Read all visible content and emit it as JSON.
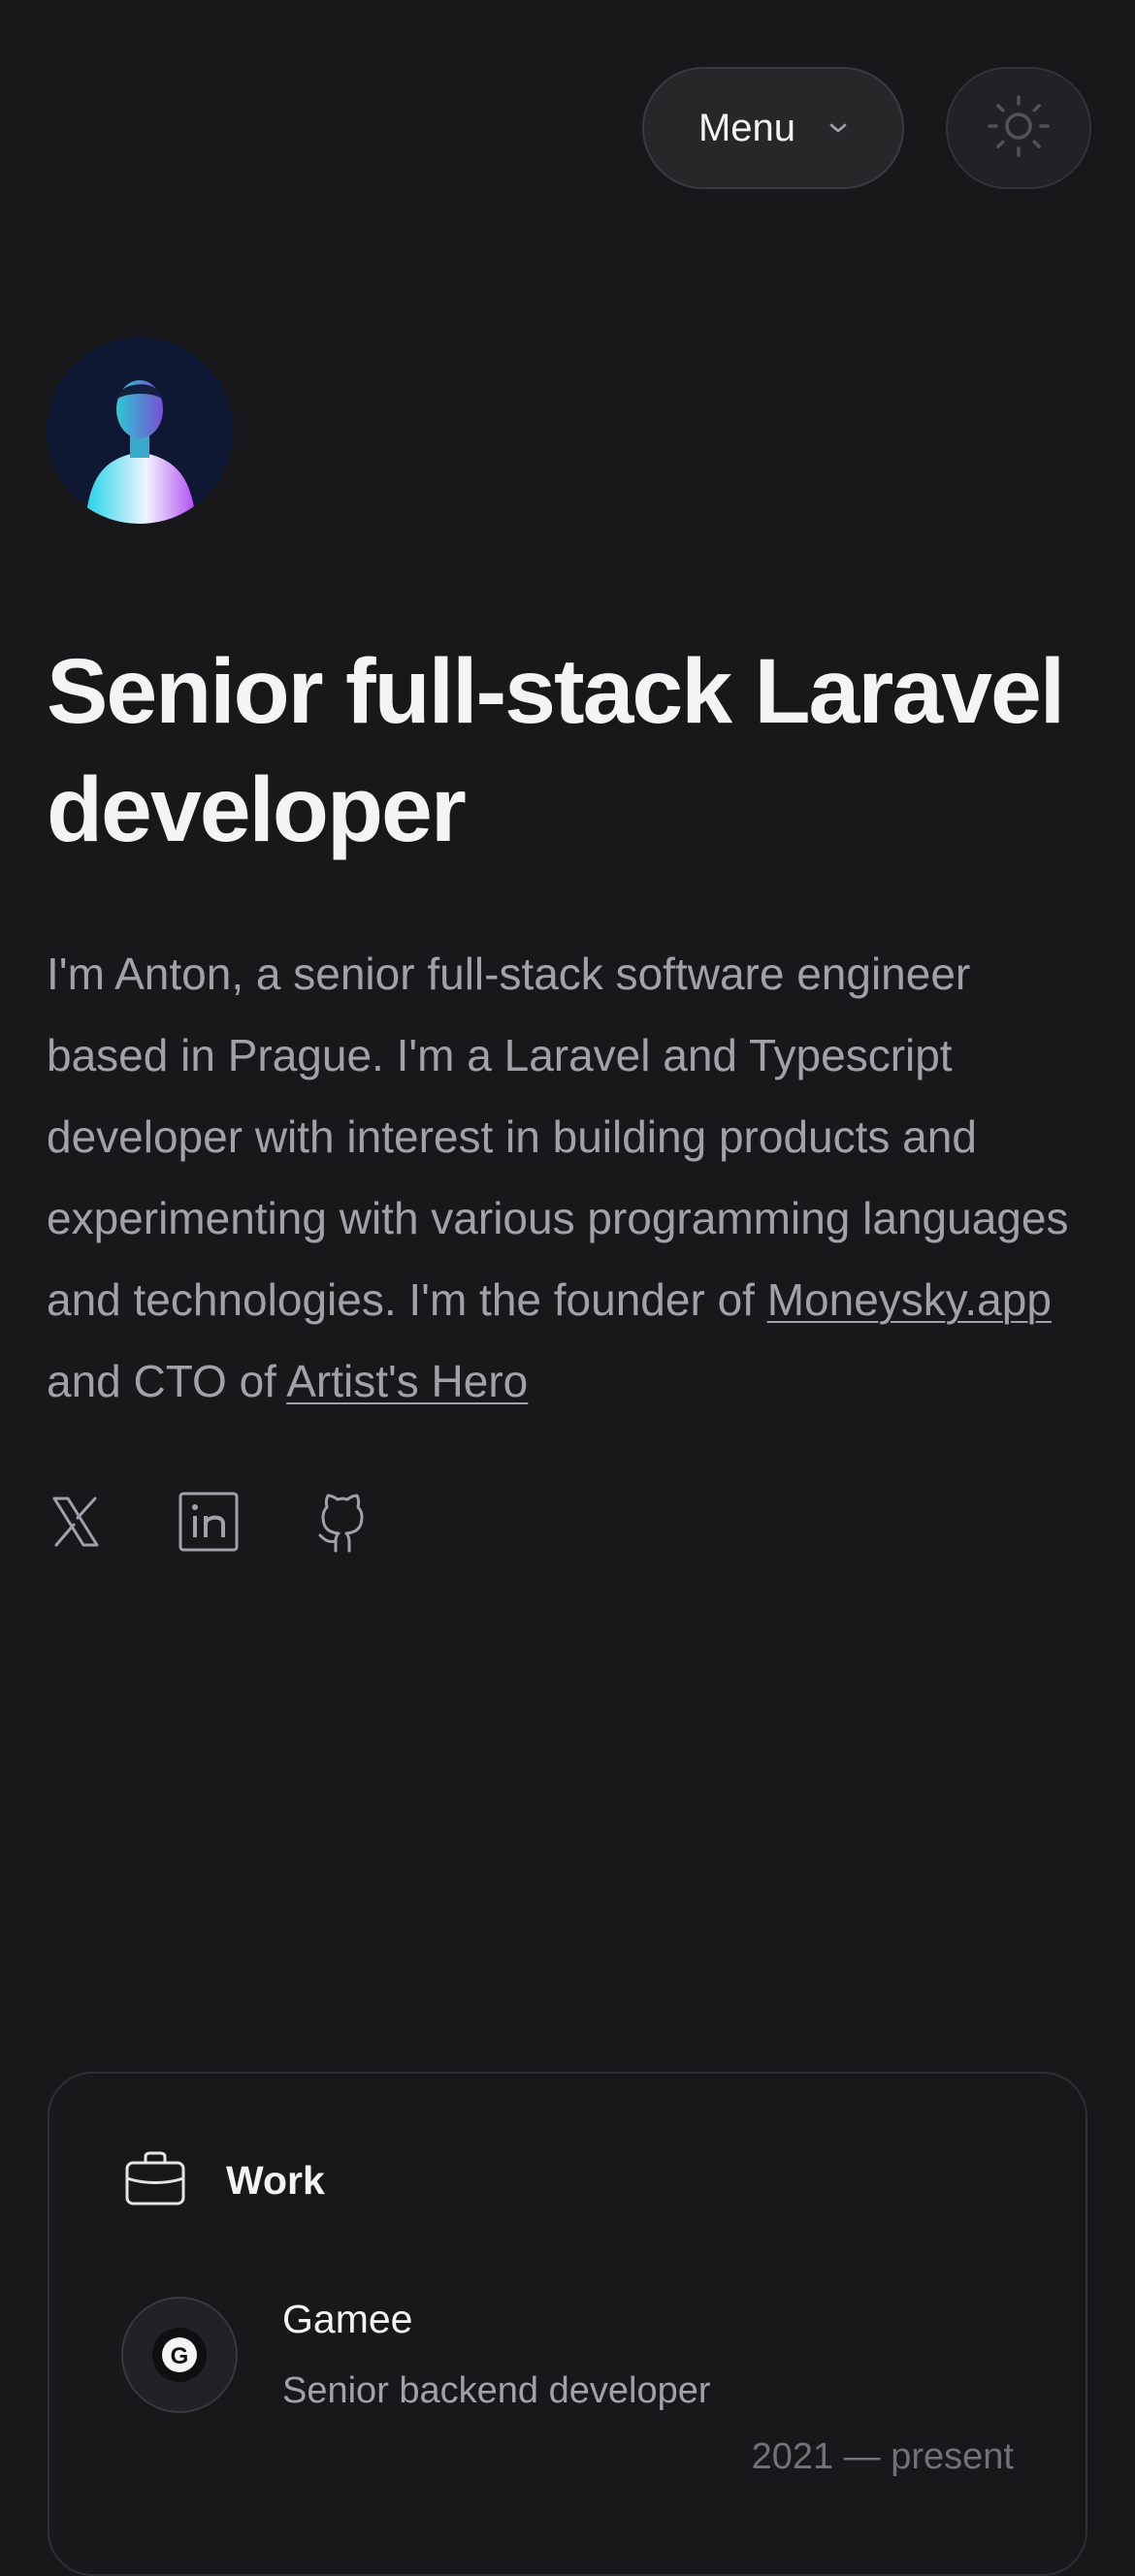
{
  "header": {
    "menu_label": "Menu",
    "menu_icon": "chevron-down-icon",
    "theme_toggle_icon": "sun-icon"
  },
  "hero": {
    "avatar": "avatar",
    "headline": "Senior full-stack Laravel developer",
    "intro_text": "I'm Anton, a senior full-stack software engineer based in Prague. I'm a Laravel and Typescript developer with interest in building products and experimenting with various programming languages and technologies. I'm the founder of",
    "link_moneysky": "Moneysky.app",
    "intro_connector": " and CTO of ",
    "link_artists_hero": "Artist's Hero"
  },
  "socials": [
    {
      "icon": "x-twitter-icon"
    },
    {
      "icon": "linkedin-icon"
    },
    {
      "icon": "github-icon"
    }
  ],
  "work": {
    "title": "Work",
    "icon": "briefcase-icon",
    "jobs": [
      {
        "company": "Gamee",
        "role": "Senior backend developer",
        "dates": "2021 — present",
        "logo_icon": "gamee-logo-icon"
      }
    ]
  },
  "colors": {
    "background": "#18181b",
    "text_primary": "#f4f4f5",
    "text_secondary": "#a1a1aa",
    "surface": "#27272a"
  }
}
